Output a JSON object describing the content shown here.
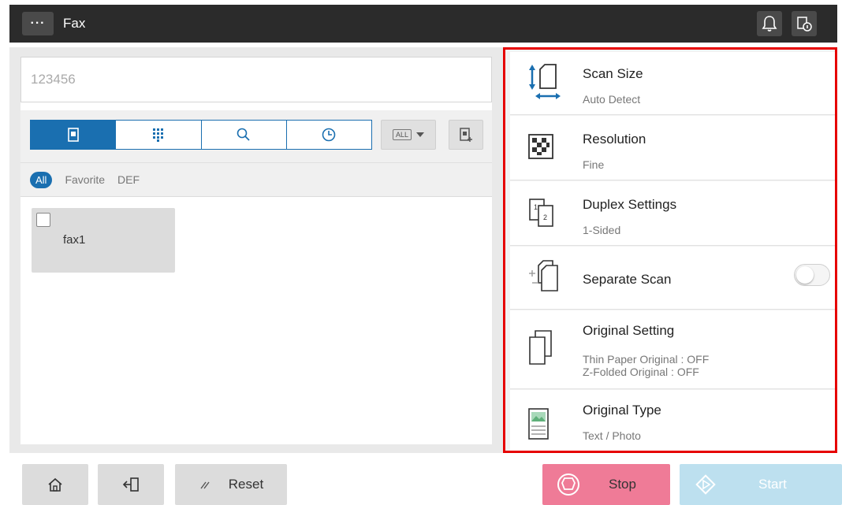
{
  "header": {
    "menu_label": "···",
    "title": "Fax",
    "icons": [
      "bell-icon",
      "user-info-icon"
    ]
  },
  "destination": {
    "input_value": "123456"
  },
  "tabs": [
    {
      "name": "address-book",
      "icon": "address-book-icon",
      "active": true
    },
    {
      "name": "keypad",
      "icon": "keypad-icon",
      "active": false
    },
    {
      "name": "search",
      "icon": "search-icon",
      "active": false
    },
    {
      "name": "history",
      "icon": "clock-icon",
      "active": false
    }
  ],
  "filter_dropdown": {
    "chip": "ALL"
  },
  "filters": {
    "all": "All",
    "favorite": "Favorite",
    "def": "DEF"
  },
  "destinations": [
    {
      "name": "fax1",
      "checked": false
    }
  ],
  "settings": [
    {
      "title": "Scan Size",
      "value": "Auto Detect",
      "icon": "scan-size-icon"
    },
    {
      "title": "Resolution",
      "value": "Fine",
      "icon": "resolution-icon"
    },
    {
      "title": "Duplex Settings",
      "value": "1-Sided",
      "icon": "duplex-icon"
    },
    {
      "title": "Separate Scan",
      "value": "",
      "icon": "separate-scan-icon",
      "toggle": false
    },
    {
      "title": "Original Setting",
      "value_lines": [
        "Thin Paper Original : OFF",
        "Z-Folded Original : OFF"
      ],
      "icon": "original-setting-icon"
    },
    {
      "title": "Original Type",
      "value": "Text / Photo",
      "icon": "original-type-icon"
    }
  ],
  "footer": {
    "reset_label": "Reset",
    "stop_label": "Stop",
    "start_label": "Start"
  },
  "colors": {
    "accent": "#1a6fb0",
    "highlight_border": "#e60000",
    "stop": "#ef7b97",
    "start": "#bde0ef",
    "header_bg": "#2b2b2b"
  }
}
